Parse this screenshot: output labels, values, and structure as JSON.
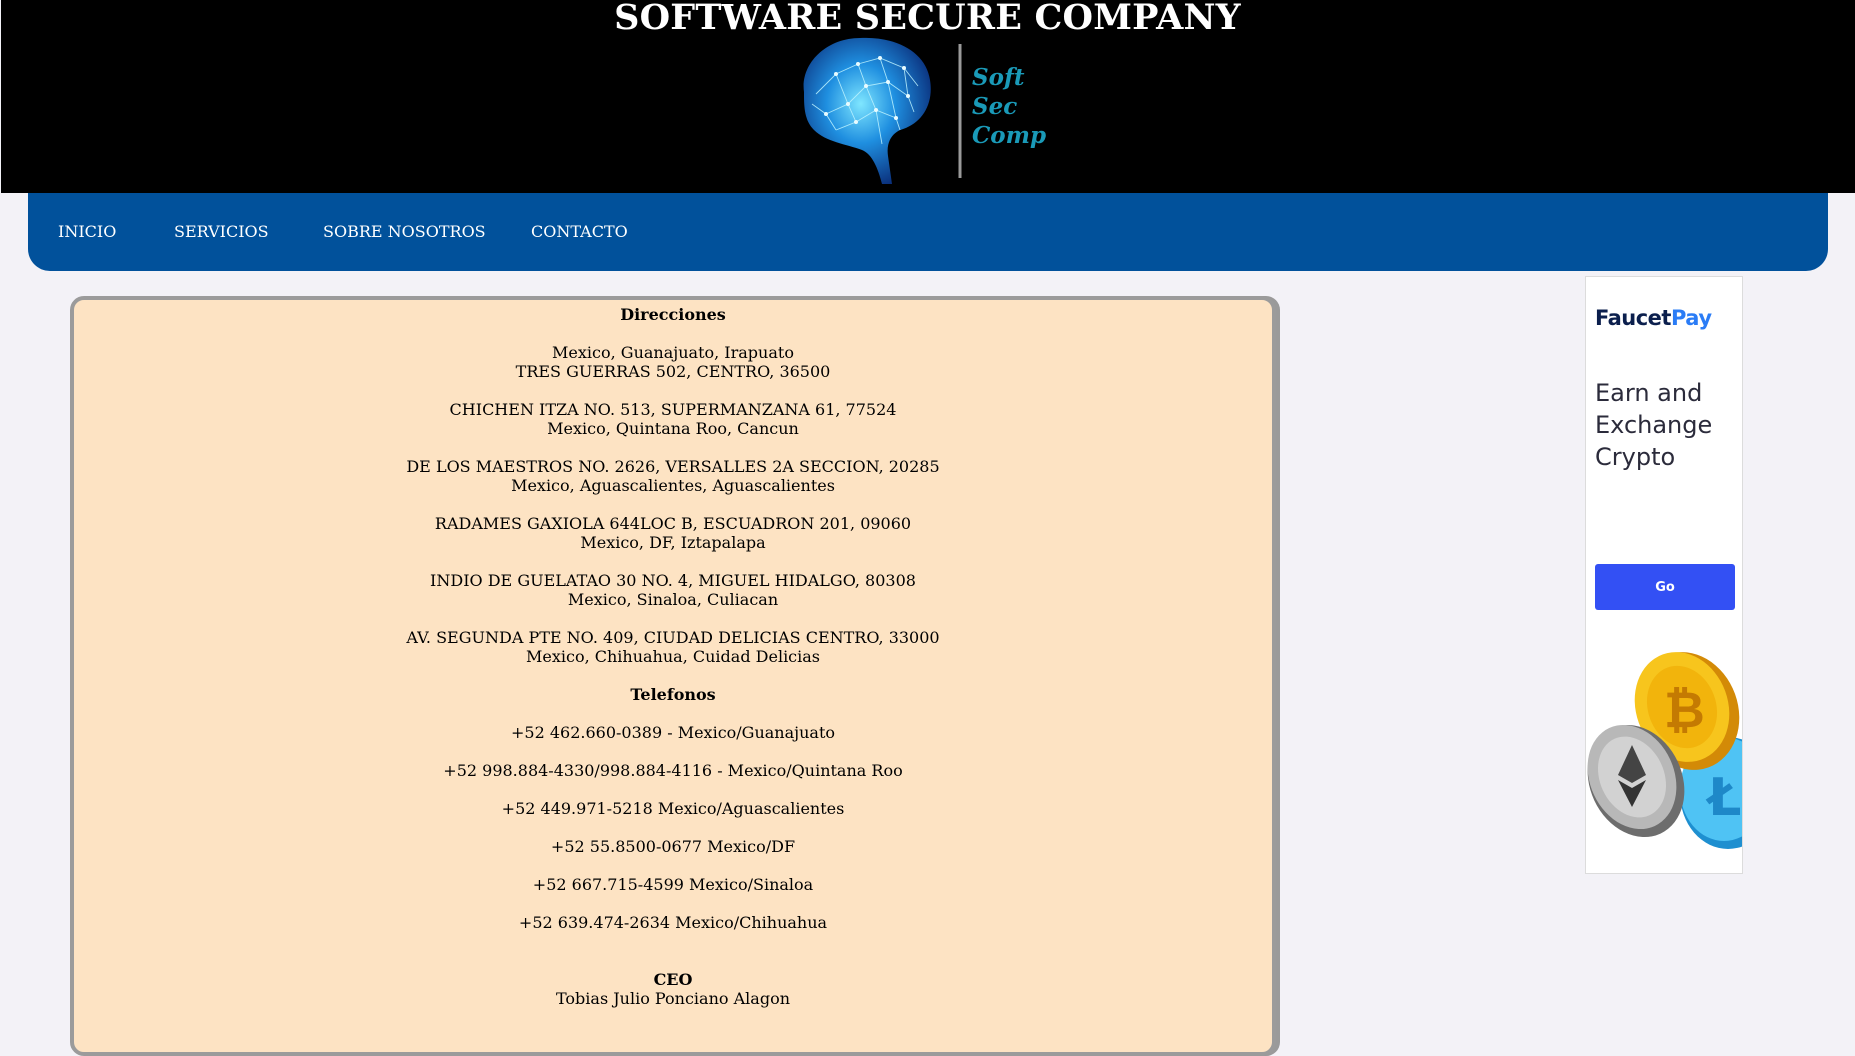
{
  "header": {
    "title": "SOFTWARE SECURE COMPANY",
    "logo_text": [
      "Soft",
      "Sec",
      "Comp"
    ]
  },
  "nav": {
    "items": [
      "INICIO",
      "SERVICIOS",
      "SOBRE NOSOTROS",
      "CONTACTO"
    ]
  },
  "content": {
    "directions_heading": "Direcciones",
    "addresses": [
      [
        "Mexico, Guanajuato, Irapuato",
        "TRES GUERRAS 502, CENTRO, 36500"
      ],
      [
        "CHICHEN ITZA NO. 513, SUPERMANZANA 61, 77524",
        "Mexico, Quintana Roo, Cancun"
      ],
      [
        "DE LOS MAESTROS NO. 2626, VERSALLES 2A SECCION, 20285",
        "Mexico, Aguascalientes, Aguascalientes"
      ],
      [
        "RADAMES GAXIOLA 644LOC B, ESCUADRON 201, 09060",
        "Mexico, DF, Iztapalapa"
      ],
      [
        "INDIO DE GUELATAO 30 NO. 4, MIGUEL HIDALGO, 80308",
        "Mexico, Sinaloa, Culiacan"
      ],
      [
        "AV. SEGUNDA PTE NO. 409, CIUDAD DELICIAS CENTRO, 33000",
        "Mexico, Chihuahua, Cuidad Delicias"
      ]
    ],
    "phones_heading": "Telefonos",
    "phones": [
      "+52 462.660-0389 - Mexico/Guanajuato",
      "+52 998.884-4330/998.884-4116 - Mexico/Quintana Roo",
      "+52 449.971-5218 Mexico/Aguascalientes",
      "+52 55.8500-0677 Mexico/DF",
      "+52 667.715-4599 Mexico/Sinaloa",
      "+52 639.474-2634 Mexico/Chihuahua"
    ],
    "ceo_heading": "CEO",
    "ceo_name": "Tobias Julio Ponciano Alagon"
  },
  "ad": {
    "brand_part1": "Faucet",
    "brand_part2": "Pay",
    "headline": "Earn and Exchange Crypto",
    "button_label": "Go"
  },
  "colors": {
    "header_bg": "#000000",
    "nav_bg": "#01519b",
    "content_bg": "#fde3c3",
    "page_bg": "#f3f2f7",
    "ad_button": "#3350f4"
  }
}
